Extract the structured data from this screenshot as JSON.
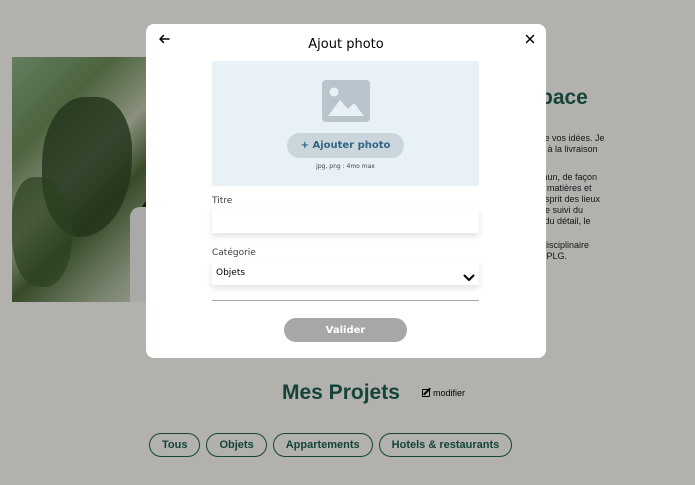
{
  "background": {
    "heading": "pace",
    "paragraphs": [
      "se vos idées. Je\nn à la livraison",
      "mun, de façon\ns matières et\nesprit des lieux\n Le suivi du\ni du détail, le",
      "idisciplinaire\nDPLG."
    ],
    "projects_title": "Mes Projets",
    "edit_label": "modifier",
    "filters": [
      "Tous",
      "Objets",
      "Appartements",
      "Hotels & restaurants"
    ]
  },
  "modal": {
    "title": "Ajout photo",
    "add_photo_label": "+ Ajouter photo",
    "upload_hint": "jpg, png : 4mo max",
    "title_label": "Titre",
    "title_value": "",
    "category_label": "Catégorie",
    "category_value": "Objets",
    "submit_label": "Valider"
  },
  "icons": {
    "back": "arrow-left-icon",
    "close": "close-icon",
    "image": "image-icon",
    "chevron": "chevron-down-icon",
    "edit": "edit-icon"
  },
  "colors": {
    "brand": "#1D6154",
    "upload_bg": "#E8F1F6",
    "upload_button": "#CBD6DC",
    "upload_button_text": "#306685",
    "disabled_button": "#A7A7A7"
  }
}
